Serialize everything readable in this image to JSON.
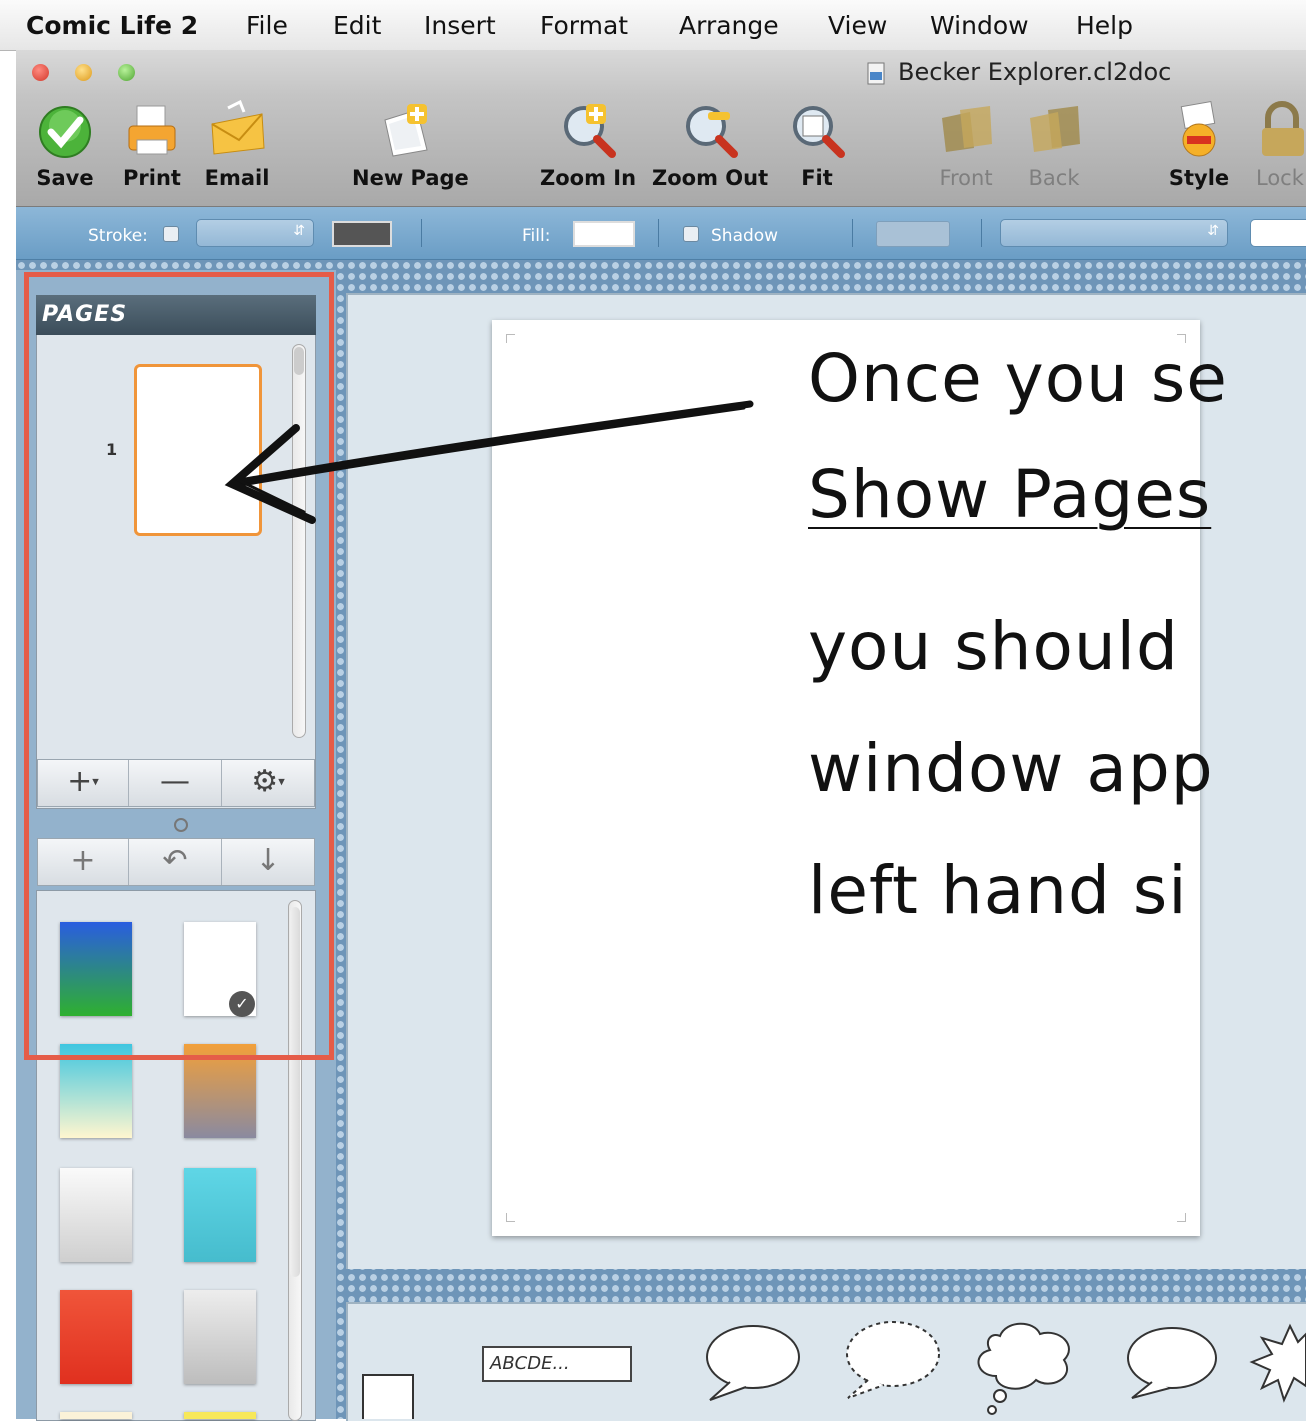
{
  "menubar": {
    "app_name": "Comic Life 2",
    "items": [
      "File",
      "Edit",
      "Insert",
      "Format",
      "Arrange",
      "View",
      "Window",
      "Help"
    ]
  },
  "window": {
    "title": "Becker Explorer.cl2doc"
  },
  "toolbar": {
    "save": "Save",
    "print": "Print",
    "email": "Email",
    "new_page": "New Page",
    "zoom_in": "Zoom In",
    "zoom_out": "Zoom Out",
    "fit": "Fit",
    "front": "Front",
    "back": "Back",
    "style": "Style",
    "lock": "Lock"
  },
  "formatbar": {
    "stroke_label": "Stroke:",
    "fill_label": "Fill:",
    "shadow_label": "Shadow"
  },
  "pages_panel": {
    "title": "PAGES",
    "page_number": "1"
  },
  "annotation": {
    "line1": "Once you se",
    "line2": "Show Pages",
    "line3": "you should",
    "line4": "window app",
    "line5": "left hand si"
  },
  "tray": {
    "text_sample": "ABCDE..."
  },
  "colors": {
    "highlight": "#e55c48",
    "page_selection": "#f0953a",
    "format_bar": "#7aa8cd"
  }
}
